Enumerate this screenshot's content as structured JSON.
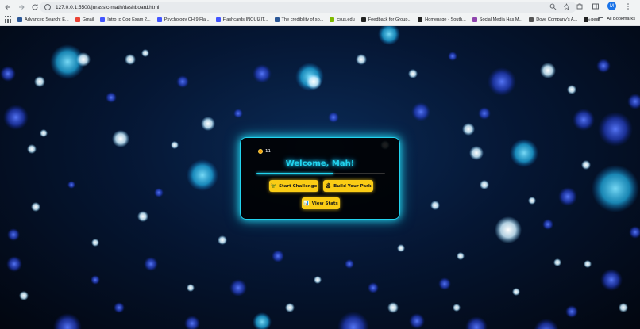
{
  "browser": {
    "url": "127.0.0.1:5500/jurassic-math/dashboard.html",
    "profile_initial": "M",
    "all_bookmarks_label": "All Bookmarks",
    "bookmarks": [
      {
        "label": "Advanced Search: E...",
        "color": "#2b5797"
      },
      {
        "label": "Gmail",
        "color": "#ea4335"
      },
      {
        "label": "Intro to Cog Exam 2...",
        "color": "#4255ff"
      },
      {
        "label": "Psychology CH 9 Fla...",
        "color": "#4255ff"
      },
      {
        "label": "Flashcards INQUIZIT...",
        "color": "#4255ff"
      },
      {
        "label": "The credibility of so...",
        "color": "#2b5797"
      },
      {
        "label": "csus.edu",
        "color": "#7fba00"
      },
      {
        "label": "Feedback for Group...",
        "color": "#222222"
      },
      {
        "label": "Homepage - South...",
        "color": "#222222"
      },
      {
        "label": "Social Media Has M...",
        "color": "#8e44ad"
      },
      {
        "label": "Dove Company's A...",
        "color": "#555555"
      },
      {
        "label": "peer",
        "color": "#222222"
      }
    ]
  },
  "dashboard": {
    "coins": "11",
    "welcome": "Welcome, Mah!",
    "progress_fraction": 0.6,
    "buttons": {
      "challenge": {
        "icon": "🦖",
        "label": "Start Challenge"
      },
      "park": {
        "icon": "🏝",
        "label": "Build Your Park"
      },
      "stats": {
        "icon": "📊",
        "label": "View Stats"
      }
    }
  },
  "colors": {
    "accent": "#22d3ee",
    "button": "#facc15"
  }
}
